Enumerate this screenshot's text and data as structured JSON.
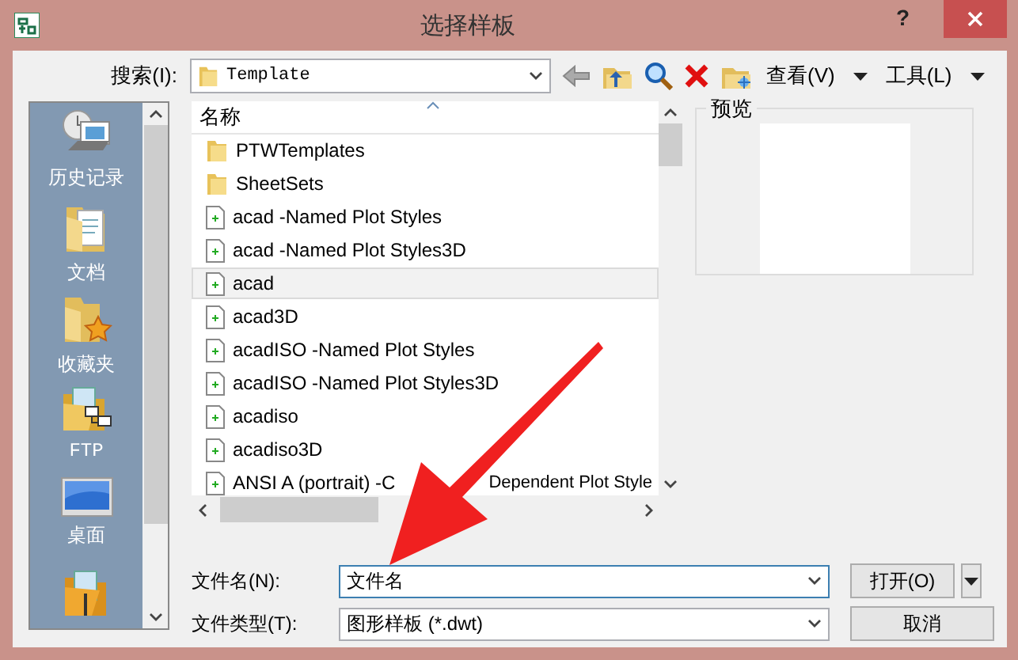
{
  "window": {
    "title": "选择样板",
    "help": "?"
  },
  "search": {
    "label": "搜索(I):",
    "location": "Template"
  },
  "menus": [
    "查看(V)",
    "工具(L)"
  ],
  "places": [
    {
      "label": "历史记录",
      "kind": "history"
    },
    {
      "label": "文档",
      "kind": "documents"
    },
    {
      "label": "收藏夹",
      "kind": "favorites"
    },
    {
      "label": "FTP",
      "kind": "ftp"
    },
    {
      "label": "桌面",
      "kind": "desktop"
    },
    {
      "kind": "buzzsaw"
    }
  ],
  "file_list": {
    "column": "名称",
    "items": [
      {
        "name": "PTWTemplates",
        "kind": "folder",
        "selected": false
      },
      {
        "name": "SheetSets",
        "kind": "folder",
        "selected": false
      },
      {
        "name": "acad -Named Plot Styles",
        "kind": "template",
        "selected": false
      },
      {
        "name": "acad -Named Plot Styles3D",
        "kind": "template",
        "selected": false
      },
      {
        "name": "acad",
        "kind": "template",
        "selected": true
      },
      {
        "name": "acad3D",
        "kind": "template",
        "selected": false
      },
      {
        "name": "acadISO -Named Plot Styles",
        "kind": "template",
        "selected": false
      },
      {
        "name": "acadISO -Named Plot Styles3D",
        "kind": "template",
        "selected": false
      },
      {
        "name": "acadiso",
        "kind": "template",
        "selected": false
      },
      {
        "name": "acadiso3D",
        "kind": "template",
        "selected": false
      },
      {
        "name": "ANSI A (portrait) -C",
        "name_after_arrow": "Dependent Plot Style",
        "kind": "template",
        "selected": false
      }
    ]
  },
  "preview": {
    "label": "预览"
  },
  "file_name": {
    "label": "文件名(N):",
    "value": "文件名"
  },
  "file_type": {
    "label": "文件类型(T):",
    "value": "图形样板 (*.dwt)"
  },
  "buttons": [
    {
      "label": "打开(O)",
      "kind": "split"
    },
    {
      "label": "取消",
      "kind": "plain"
    }
  ]
}
